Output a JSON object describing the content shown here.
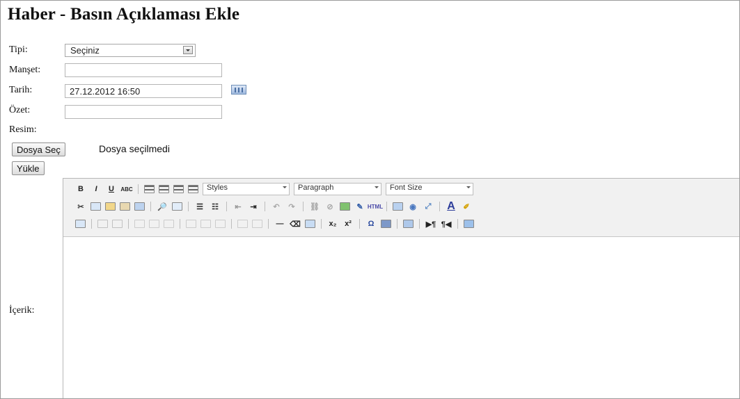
{
  "title": "Haber - Basın Açıklaması Ekle",
  "form": {
    "tipi_label": "Tipi:",
    "tipi_value": "Seçiniz",
    "manset_label": "Manşet:",
    "manset_value": "",
    "tarih_label": "Tarih:",
    "tarih_value": "27.12.2012 16:50",
    "ozet_label": "Özet:",
    "ozet_value": "",
    "resim_label": "Resim:",
    "choose_file_button": "Dosya Seç",
    "file_status": "Dosya seçilmedi",
    "upload_button": "Yükle",
    "content_label": "İçerik:"
  },
  "editor": {
    "styles_label": "Styles",
    "paragraph_label": "Paragraph",
    "font_size_label": "Font Size",
    "content": ""
  }
}
